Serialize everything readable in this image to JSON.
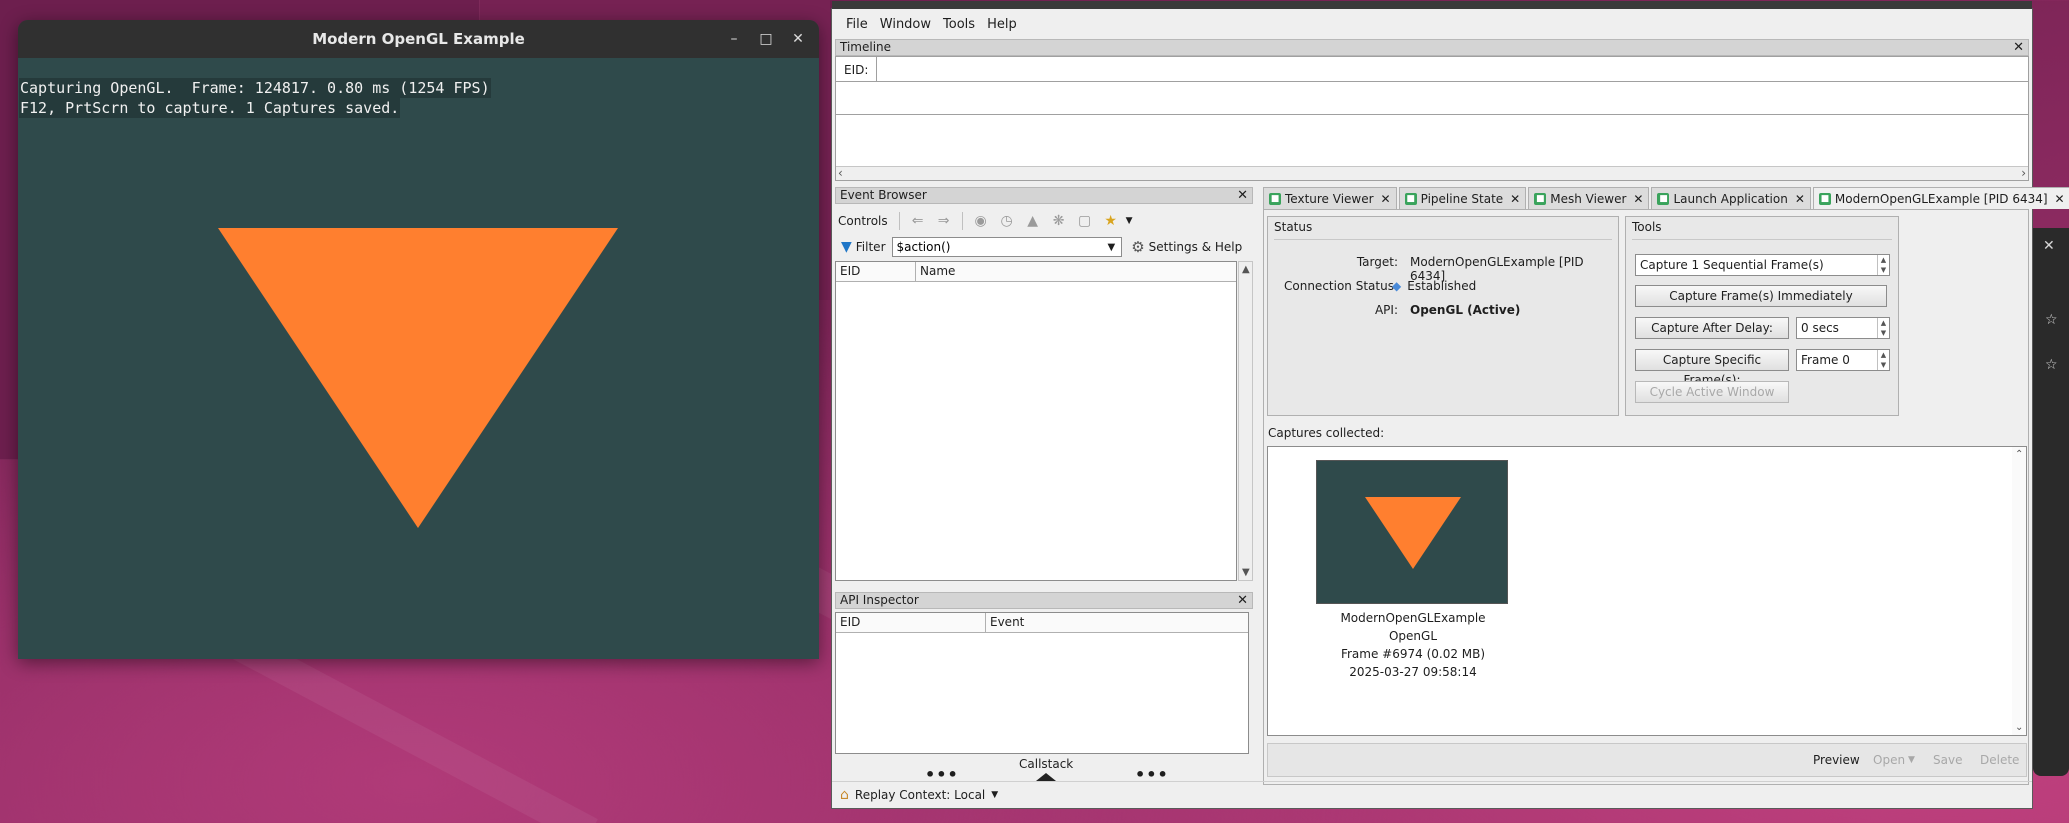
{
  "gl_window": {
    "title": "Modern OpenGL Example",
    "overlay_line1": "Capturing OpenGL.  Frame: 124817. 0.80 ms (1254 FPS)",
    "overlay_line2": "F12, PrtScrn to capture. 1 Captures saved.",
    "clear_color": "#2f4a4b",
    "triangle_color": "#ff7f2f"
  },
  "menubar": {
    "items": [
      "File",
      "Window",
      "Tools",
      "Help"
    ]
  },
  "timeline": {
    "title": "Timeline",
    "eid_label": "EID:"
  },
  "event_browser": {
    "title": "Event Browser",
    "controls_label": "Controls",
    "filter_label": "Filter",
    "filter_value": "$action()",
    "settings_help": "Settings & Help",
    "columns": [
      "EID",
      "Name"
    ]
  },
  "api_inspector": {
    "title": "API Inspector",
    "columns": [
      "EID",
      "Event"
    ],
    "callstack_label": "Callstack"
  },
  "status_bar": {
    "replay_context": "Replay Context: Local"
  },
  "tabs": [
    {
      "label": "Texture Viewer"
    },
    {
      "label": "Pipeline State"
    },
    {
      "label": "Mesh Viewer"
    },
    {
      "label": "Launch Application"
    },
    {
      "label": "ModernOpenGLExample [PID 6434]"
    }
  ],
  "status_box": {
    "title": "Status",
    "target_label": "Target:",
    "target_value": "ModernOpenGLExample [PID 6434]",
    "connection_label": "Connection Status:",
    "connection_value": "Established",
    "api_label": "API:",
    "api_value": "OpenGL (Active)"
  },
  "tools_box": {
    "title": "Tools",
    "sequential_value": "Capture 1 Sequential Frame(s)",
    "capture_now": "Capture Frame(s) Immediately",
    "capture_delay": "Capture After Delay:",
    "delay_value": "0 secs",
    "capture_specific": "Capture Specific Frame(s):",
    "frame_value": "Frame 0",
    "cycle_window": "Cycle Active Window"
  },
  "captures": {
    "label": "Captures collected:",
    "items": [
      {
        "name": "ModernOpenGLExample",
        "api": "OpenGL",
        "frame": "Frame #6974 (0.02 MB)",
        "timestamp": "2025-03-27 09:58:14"
      }
    ]
  },
  "capture_actions": {
    "preview": "Preview",
    "open": "Open",
    "save": "Save",
    "delete": "Delete"
  }
}
